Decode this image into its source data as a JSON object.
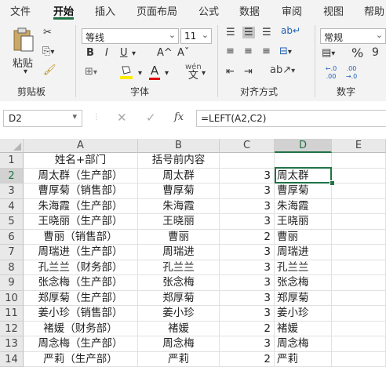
{
  "tabs": [
    "文件",
    "开始",
    "插入",
    "页面布局",
    "公式",
    "数据",
    "审阅",
    "视图",
    "帮助"
  ],
  "active_tab": "开始",
  "ribbon": {
    "clipboard": {
      "paste_label": "粘贴",
      "group_label": "剪贴板"
    },
    "font": {
      "font_name": "等线",
      "font_size": "11",
      "bold": "B",
      "italic": "I",
      "underline": "U",
      "grow": "A^",
      "shrink": "Aˇ",
      "group_label": "字体",
      "wen_label": "wén",
      "wen_char": "文"
    },
    "alignment": {
      "group_label": "对齐方式"
    },
    "number": {
      "format": "常规",
      "percent": "%",
      "comma": "9",
      "group_label": "数字",
      "inc_decimal": "←.0 .00",
      "dec_decimal": ".00 →.0"
    }
  },
  "namebox": "D2",
  "formula_icons": {
    "cancel": "✕",
    "confirm": "✓",
    "fx": "fx"
  },
  "formula": "=LEFT(A2,C2)",
  "accent": "#217346",
  "columns": [
    "A",
    "B",
    "C",
    "D",
    "E"
  ],
  "rows": [
    {
      "n": "1",
      "a": "姓名+部门",
      "b": "括号前内容",
      "c": "",
      "d": ""
    },
    {
      "n": "2",
      "a": "周太群（生产部）",
      "b": "周太群",
      "c": "3",
      "d": "周太群"
    },
    {
      "n": "3",
      "a": "曹厚菊（销售部）",
      "b": "曹厚菊",
      "c": "3",
      "d": "曹厚菊"
    },
    {
      "n": "4",
      "a": "朱海霞（生产部）",
      "b": "朱海霞",
      "c": "3",
      "d": "朱海霞"
    },
    {
      "n": "5",
      "a": "王晓丽（生产部）",
      "b": "王晓丽",
      "c": "3",
      "d": "王晓丽"
    },
    {
      "n": "6",
      "a": "曹丽（销售部）",
      "b": "曹丽",
      "c": "2",
      "d": "曹丽"
    },
    {
      "n": "7",
      "a": "周瑞进（生产部）",
      "b": "周瑞进",
      "c": "3",
      "d": "周瑞进"
    },
    {
      "n": "8",
      "a": "孔兰兰（财务部）",
      "b": "孔兰兰",
      "c": "3",
      "d": "孔兰兰"
    },
    {
      "n": "9",
      "a": "张念梅（生产部）",
      "b": "张念梅",
      "c": "3",
      "d": "张念梅"
    },
    {
      "n": "10",
      "a": "郑厚菊（生产部）",
      "b": "郑厚菊",
      "c": "3",
      "d": "郑厚菊"
    },
    {
      "n": "11",
      "a": "姜小珍（销售部）",
      "b": "姜小珍",
      "c": "3",
      "d": "姜小珍"
    },
    {
      "n": "12",
      "a": "褚媛（财务部）",
      "b": "褚媛",
      "c": "2",
      "d": "褚媛"
    },
    {
      "n": "13",
      "a": "周念梅（生产部）",
      "b": "周念梅",
      "c": "3",
      "d": "周念梅"
    },
    {
      "n": "14",
      "a": "严莉（生产部）",
      "b": "严莉",
      "c": "2",
      "d": "严莉"
    }
  ]
}
